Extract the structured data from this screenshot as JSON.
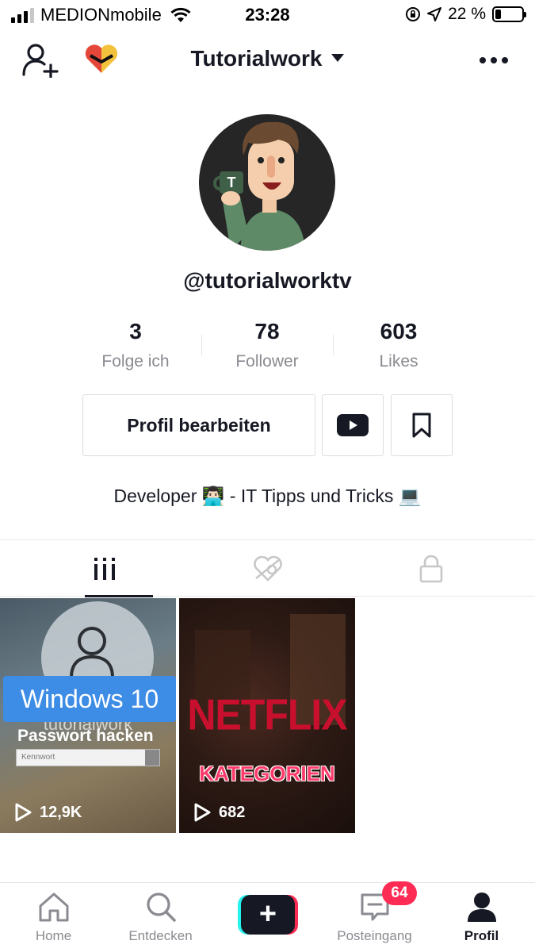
{
  "status_bar": {
    "carrier": "MEDIONmobile",
    "time": "23:28",
    "battery": "22 %",
    "battery_level": 0.22
  },
  "header": {
    "title": "Tutorialwork",
    "icons": [
      "add-user-icon",
      "heart-badge-icon",
      "more-icon"
    ]
  },
  "profile": {
    "username": "@tutorialworktv",
    "avatar_initial": "T",
    "stats": [
      {
        "value": "3",
        "label": "Folge ich"
      },
      {
        "value": "78",
        "label": "Follower"
      },
      {
        "value": "603",
        "label": "Likes"
      }
    ],
    "edit_button": "Profil bearbeiten",
    "bio": "Developer 👨🏻‍💻 - IT Tipps und Tricks 💻"
  },
  "tabs": [
    "videos-grid-icon",
    "liked-icon",
    "private-lock-icon"
  ],
  "videos": [
    {
      "badge": "Windows 10",
      "watermark": "tutorialwork",
      "subtitle": "Passwort hacken",
      "placeholder": "Kennwort",
      "views": "12,9K"
    },
    {
      "title": "NETFLIX",
      "subtitle": "KATEGORIEN",
      "views": "682"
    }
  ],
  "bottom_nav": {
    "items": [
      {
        "label": "Home",
        "icon": "home-icon"
      },
      {
        "label": "Entdecken",
        "icon": "search-icon"
      },
      {
        "label": "",
        "icon": "plus-icon"
      },
      {
        "label": "Posteingang",
        "icon": "inbox-icon"
      },
      {
        "label": "Profil",
        "icon": "profile-icon"
      }
    ],
    "inbox_badge": "64"
  },
  "colors": {
    "accent": "#fe2c55",
    "cyan": "#25f4ee",
    "text": "#161823",
    "muted": "#8a8b91"
  }
}
